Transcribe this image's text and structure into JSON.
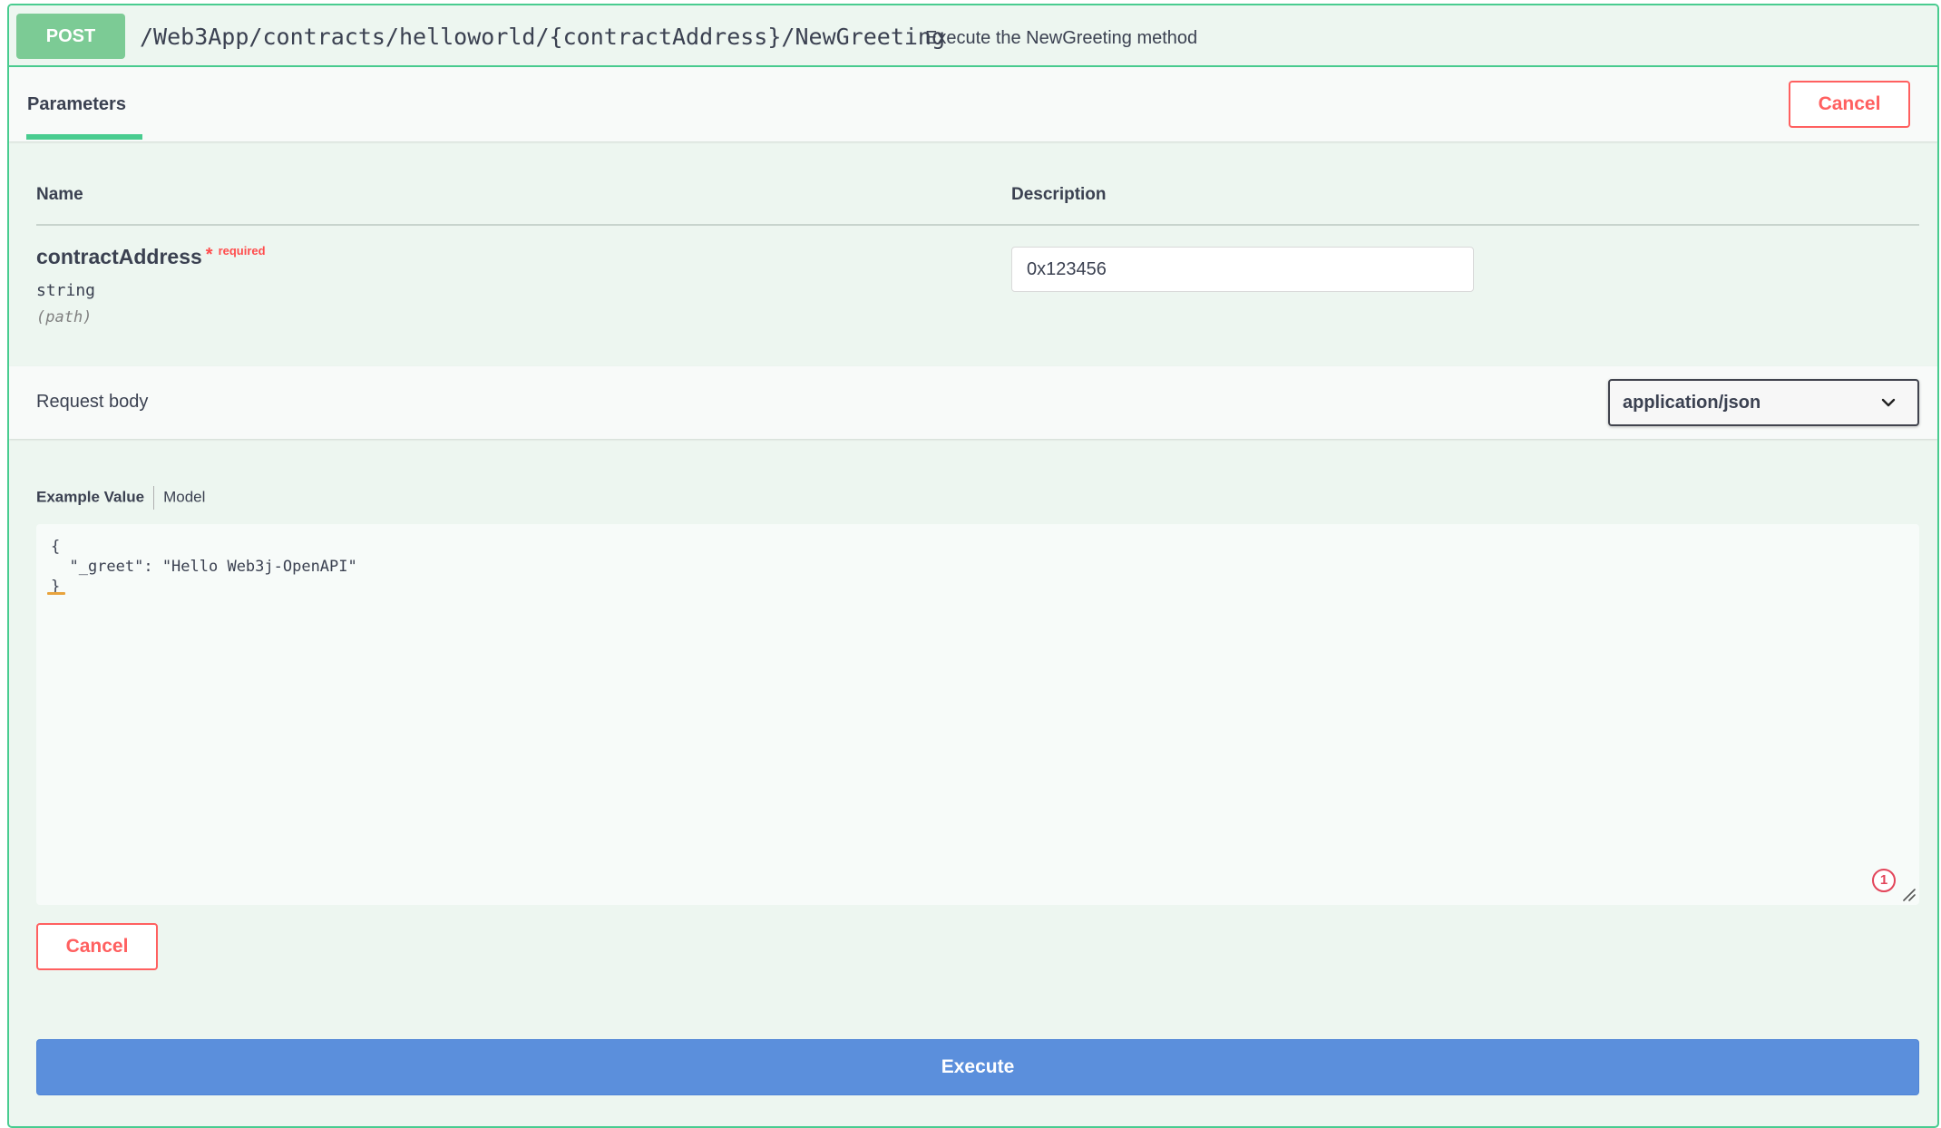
{
  "operation": {
    "method": "POST",
    "path": "/Web3App/contracts/helloworld/{contractAddress}/NewGreeting",
    "description": "Execute the NewGreeting method"
  },
  "parameters_section": {
    "tab_label": "Parameters",
    "cancel_label": "Cancel",
    "columns": {
      "name": "Name",
      "description": "Description"
    },
    "params": [
      {
        "name": "contractAddress",
        "required_star": "*",
        "required_label": "required",
        "type": "string",
        "in": "(path)",
        "value": "0x123456"
      }
    ]
  },
  "request_body": {
    "title": "Request body",
    "content_type": "application/json",
    "tabs": {
      "example_value": "Example Value",
      "model": "Model"
    },
    "example_code": "{\n  \"_greet\": \"Hello Web3j-OpenAPI\"\n}",
    "problem_count": "1"
  },
  "actions": {
    "cancel_label": "Cancel",
    "execute_label": "Execute"
  },
  "colors": {
    "post_green": "#49cc90",
    "method_badge": "#7ccb95",
    "cancel_red": "#ff6060",
    "execute_blue": "#5b8fdc",
    "block_background": "#edf6f0"
  },
  "icons": {
    "dropdown": "chevron-down-icon",
    "problem_badge": "error-count-icon",
    "resize": "resize-handle-icon"
  }
}
